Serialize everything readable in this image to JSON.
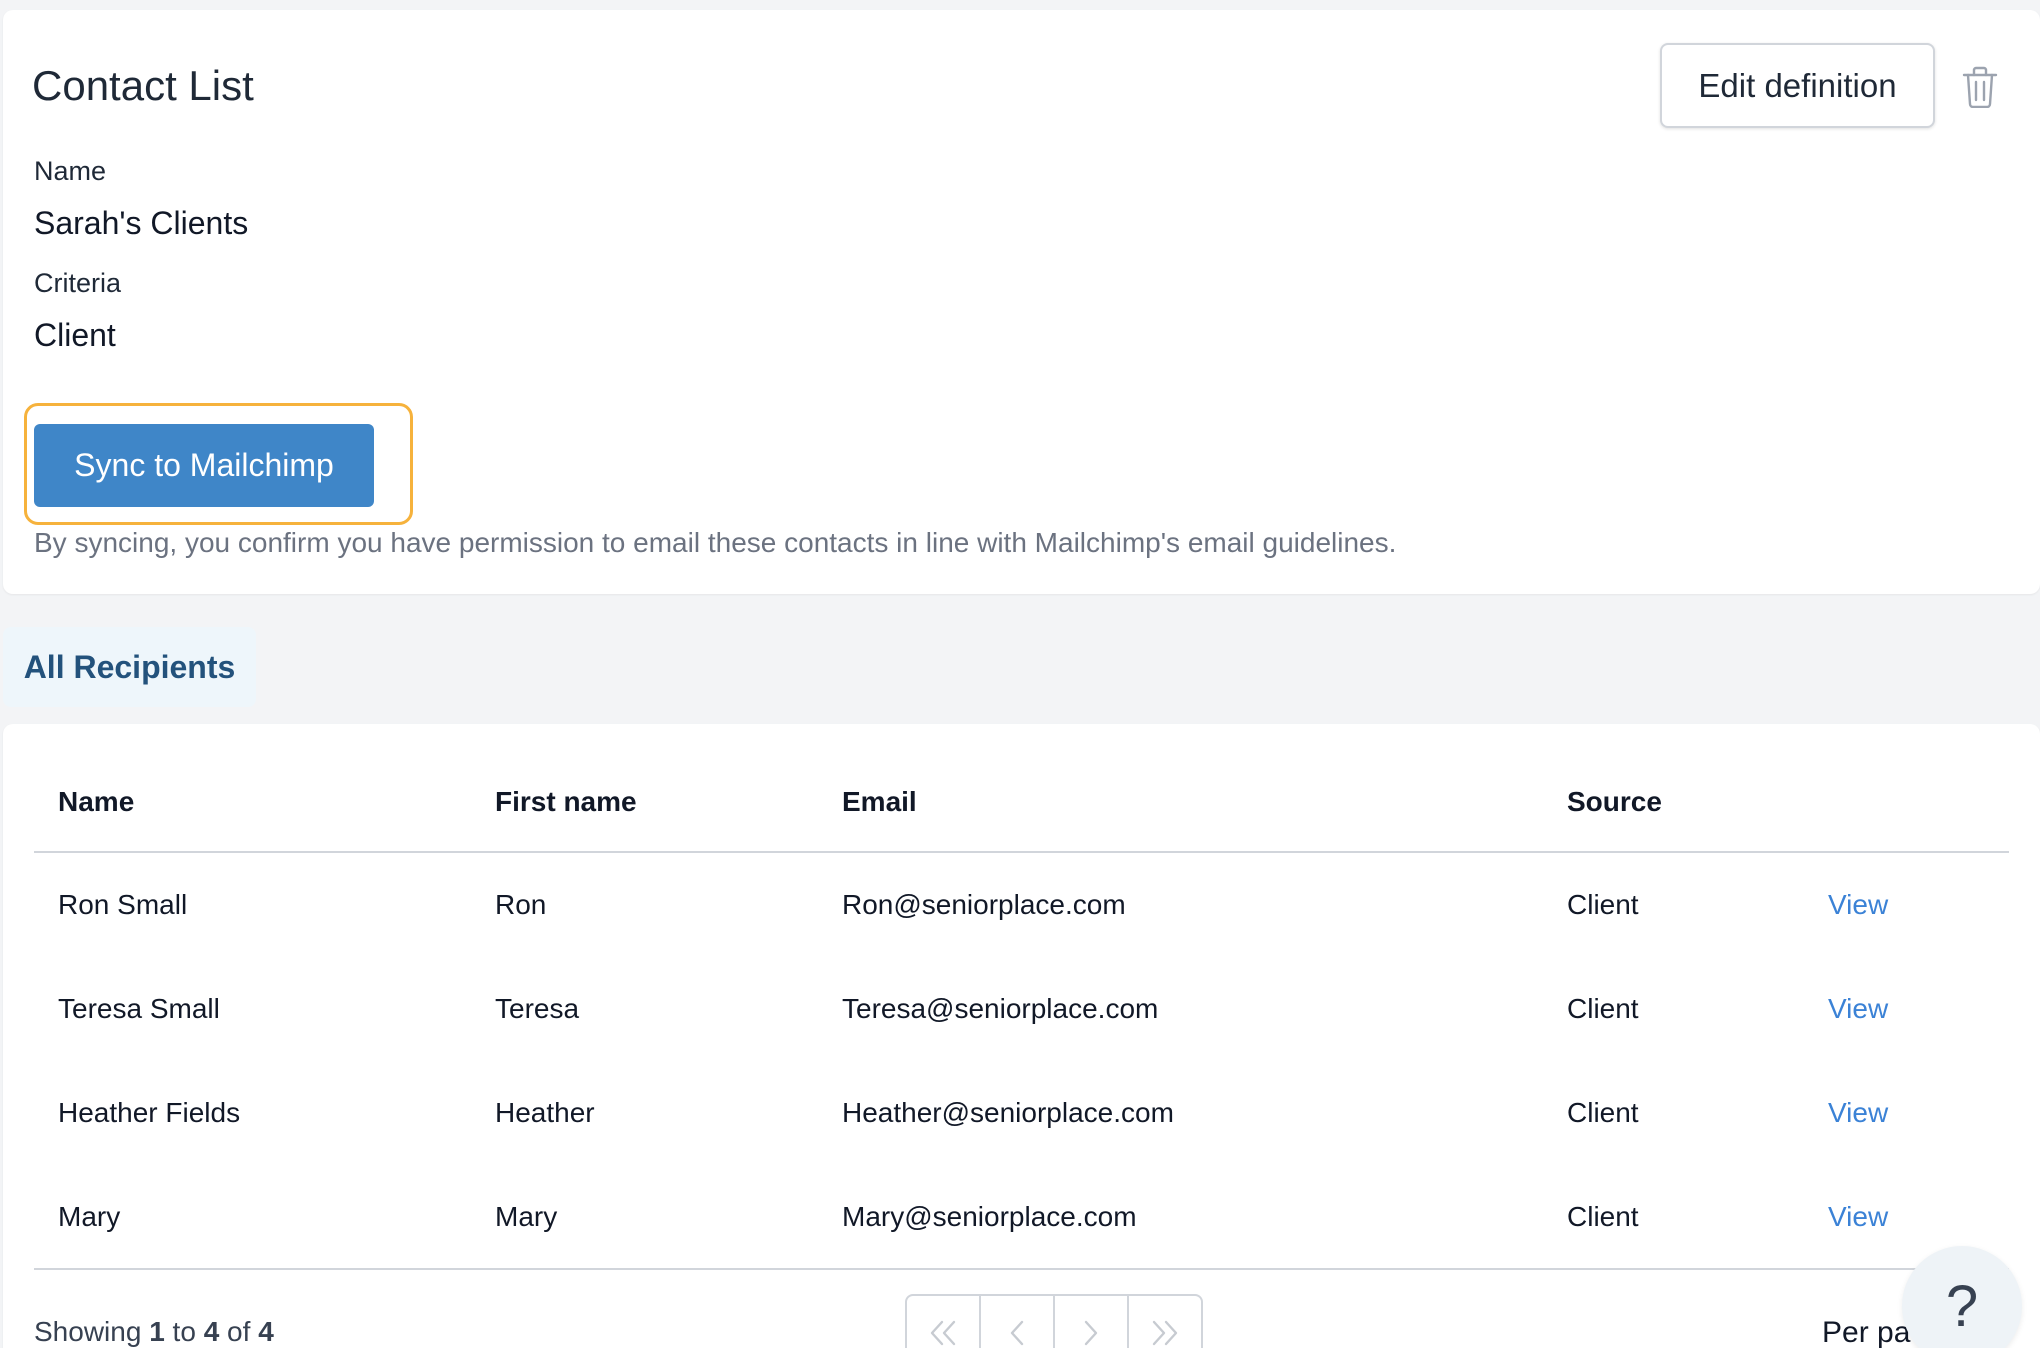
{
  "header": {
    "title": "Contact List",
    "edit_label": "Edit definition"
  },
  "definition": {
    "name_label": "Name",
    "name_value": "Sarah's Clients",
    "criteria_label": "Criteria",
    "criteria_value": "Client"
  },
  "sync": {
    "button_label": "Sync to Mailchimp",
    "disclaimer": "By syncing, you confirm you have permission to email these contacts in line with Mailchimp's email guidelines."
  },
  "tabs": [
    {
      "label": "All Recipients",
      "active": true
    }
  ],
  "table": {
    "columns": [
      "Name",
      "First name",
      "Email",
      "Source"
    ],
    "rows": [
      {
        "name": "Ron Small",
        "first_name": "Ron",
        "email": "Ron@seniorplace.com",
        "source": "Client",
        "action": "View"
      },
      {
        "name": "Teresa Small",
        "first_name": "Teresa",
        "email": "Teresa@seniorplace.com",
        "source": "Client",
        "action": "View"
      },
      {
        "name": "Heather Fields",
        "first_name": "Heather",
        "email": "Heather@seniorplace.com",
        "source": "Client",
        "action": "View"
      },
      {
        "name": "Mary",
        "first_name": "Mary",
        "email": "Mary@seniorplace.com",
        "source": "Client",
        "action": "View"
      }
    ]
  },
  "footer": {
    "showing_prefix": "Showing",
    "showing_from": "1",
    "showing_to_word": "to",
    "showing_to": "4",
    "showing_of_word": "of",
    "showing_total": "4",
    "per_page_label": "Per pa",
    "pager_icons": [
      "first-page-icon",
      "prev-page-icon",
      "next-page-icon",
      "last-page-icon"
    ]
  },
  "help": {
    "label": "?"
  },
  "colors": {
    "accent": "#3f86c8",
    "highlight": "#f6b23c",
    "link": "#3b82d6",
    "tab_bg": "#eef6fb",
    "tab_text": "#23527c"
  }
}
